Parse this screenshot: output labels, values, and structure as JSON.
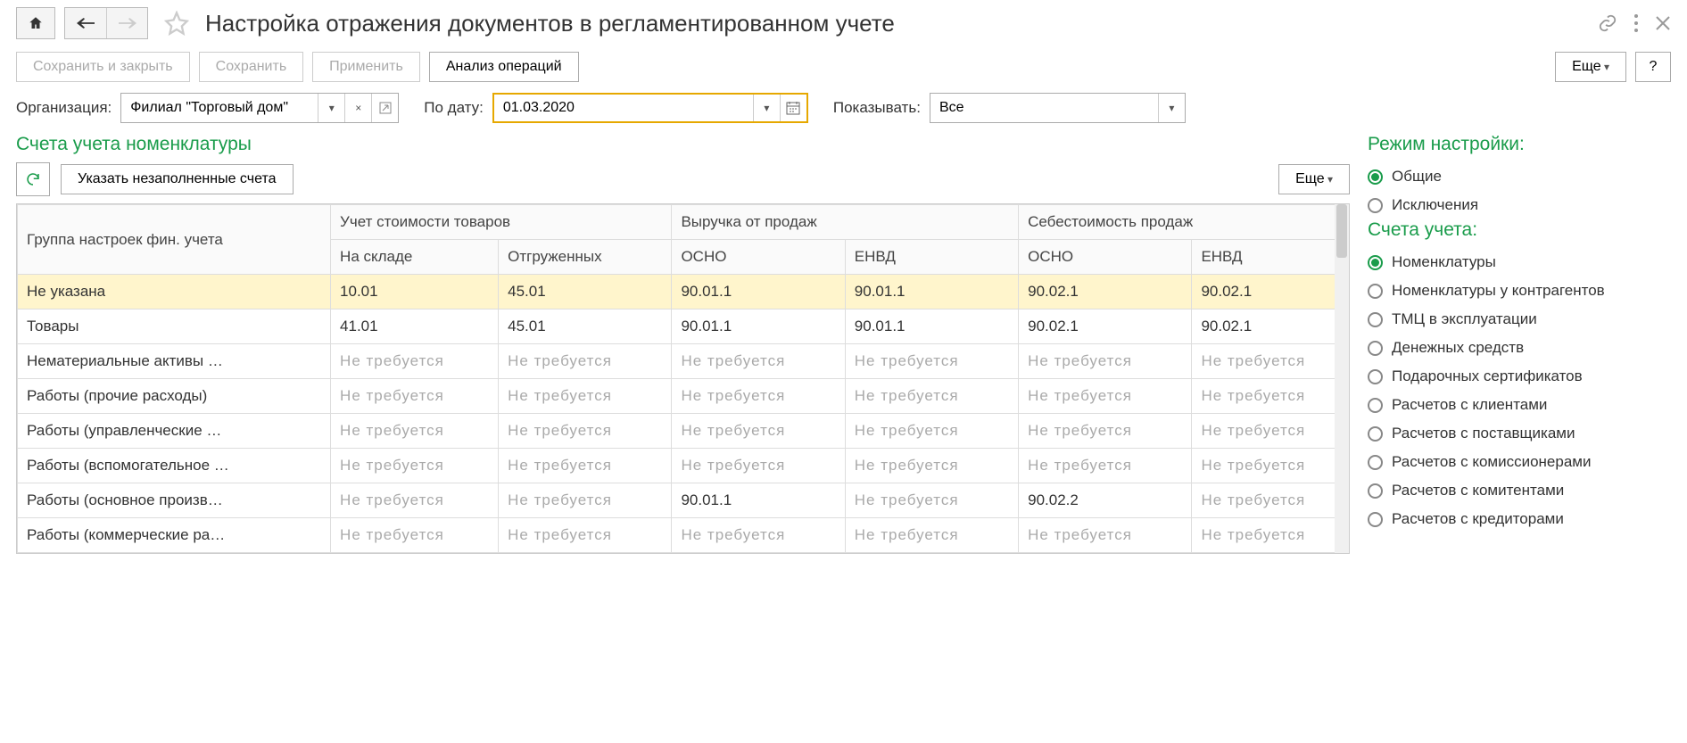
{
  "header": {
    "title": "Настройка отражения документов в регламентированном учете"
  },
  "toolbar": {
    "save_close": "Сохранить и закрыть",
    "save": "Сохранить",
    "apply": "Применить",
    "analysis": "Анализ операций",
    "more": "Еще",
    "help": "?"
  },
  "filters": {
    "org_label": "Организация:",
    "org_value": "Филиал \"Торговый дом\"",
    "date_label": "По дату:",
    "date_value": "01.03.2020",
    "show_label": "Показывать:",
    "show_value": "Все"
  },
  "accounts_section": {
    "title": "Счета учета номенклатуры",
    "fill_btn": "Указать незаполненные счета",
    "more": "Еще",
    "columns": {
      "group": "Группа настроек фин. учета",
      "cost": "Учет стоимости товаров",
      "revenue": "Выручка от продаж",
      "cogs": "Себестоимость продаж",
      "on_stock": "На складе",
      "shipped": "Отгруженных",
      "osno1": "ОСНО",
      "envd1": "ЕНВД",
      "osno2": "ОСНО",
      "envd2": "ЕНВД"
    },
    "not_required": "Не требуется",
    "rows": [
      {
        "group": "Не указана",
        "c": [
          "10.01",
          "45.01",
          "90.01.1",
          "90.01.1",
          "90.02.1",
          "90.02.1"
        ],
        "hl": true
      },
      {
        "group": "Товары",
        "c": [
          "41.01",
          "45.01",
          "90.01.1",
          "90.01.1",
          "90.02.1",
          "90.02.1"
        ]
      },
      {
        "group": "Нематериальные активы …",
        "c": [
          "NR",
          "NR",
          "NR",
          "NR",
          "NR",
          "NR"
        ]
      },
      {
        "group": "Работы (прочие расходы)",
        "c": [
          "NR",
          "NR",
          "NR",
          "NR",
          "NR",
          "NR"
        ]
      },
      {
        "group": "Работы (управленческие …",
        "c": [
          "NR",
          "NR",
          "NR",
          "NR",
          "NR",
          "NR"
        ]
      },
      {
        "group": "Работы (вспомогательное …",
        "c": [
          "NR",
          "NR",
          "NR",
          "NR",
          "NR",
          "NR"
        ]
      },
      {
        "group": "Работы (основное произв…",
        "c": [
          "NR",
          "NR",
          "90.01.1",
          "NR",
          "90.02.2",
          "NR"
        ]
      },
      {
        "group": "Работы (коммерческие ра…",
        "c": [
          "NR",
          "NR",
          "NR",
          "NR",
          "NR",
          "NR"
        ]
      }
    ]
  },
  "right_panel": {
    "mode_title": "Режим настройки:",
    "mode_options": [
      {
        "label": "Общие",
        "selected": true
      },
      {
        "label": "Исключения",
        "selected": false
      }
    ],
    "accounts_title": "Счета учета:",
    "accounts_options": [
      {
        "label": "Номенклатуры",
        "selected": true
      },
      {
        "label": "Номенклатуры у контрагентов"
      },
      {
        "label": "ТМЦ в эксплуатации"
      },
      {
        "label": "Денежных средств"
      },
      {
        "label": "Подарочных сертификатов"
      },
      {
        "label": "Расчетов с клиентами"
      },
      {
        "label": "Расчетов с поставщиками"
      },
      {
        "label": "Расчетов с комиссионерами"
      },
      {
        "label": "Расчетов с комитентами"
      },
      {
        "label": "Расчетов с кредиторами"
      }
    ]
  }
}
